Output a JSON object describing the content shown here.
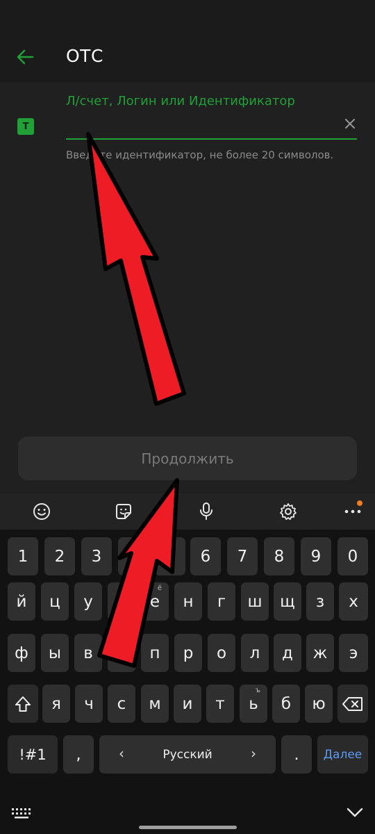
{
  "app_bar": {
    "title": "ОТС"
  },
  "field": {
    "icon_letter": "Т",
    "label": "Л/счет, Логин или Идентификатор",
    "value": "",
    "hint": "Введите идентификатор, не более 20 символов."
  },
  "continue_button": {
    "label": "Продолжить"
  },
  "keyboard_toolbar": {
    "items": [
      "emoji-icon",
      "sticker-icon",
      "microphone-icon",
      "gear-icon",
      "more-icon"
    ],
    "badge_color": "#f07d21"
  },
  "keyboard": {
    "row_numbers": [
      "1",
      "2",
      "3",
      "4",
      "5",
      "6",
      "7",
      "8",
      "9",
      "0"
    ],
    "row1": [
      "й",
      "ц",
      "у",
      "к",
      "е",
      "н",
      "г",
      "ш",
      "щ",
      "з",
      "х"
    ],
    "row1_hint_e": "ё",
    "row2": [
      "ф",
      "ы",
      "в",
      "а",
      "п",
      "р",
      "о",
      "л",
      "д",
      "ж",
      "э"
    ],
    "row3": [
      "я",
      "ч",
      "с",
      "м",
      "и",
      "т",
      "ь",
      "б",
      "ю"
    ],
    "row3_hint_soft": "ъ",
    "symbols_key": "!#1",
    "comma_key": ",",
    "space_label": "Русский",
    "space_left_arrow": "‹",
    "space_right_arrow": "›",
    "period_key": ".",
    "done_key": "Далее"
  },
  "colors": {
    "accent": "#21a038",
    "background": "#202020",
    "keyboard_bg": "#121212",
    "key_bg": "#2f2f2f",
    "done_text": "#5b9bf1",
    "annotation_arrow": "#ee1c25"
  }
}
